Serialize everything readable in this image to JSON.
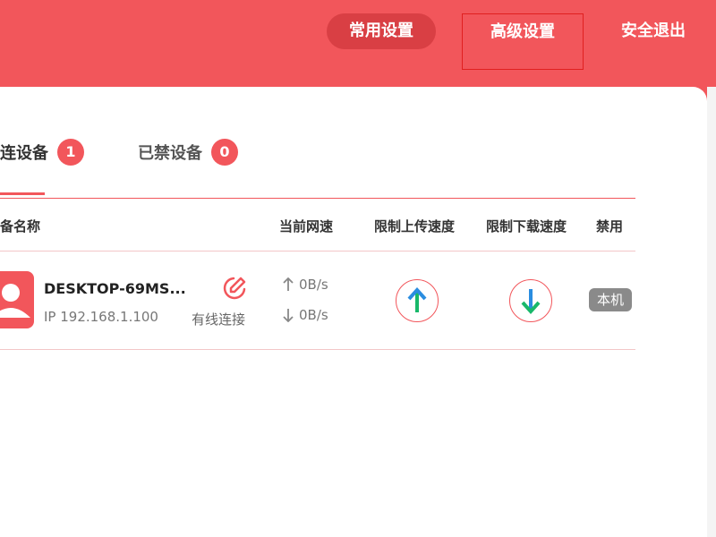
{
  "nav": {
    "common_settings": "常用设置",
    "advanced_settings": "高级设置",
    "logout": "安全退出"
  },
  "tabs": {
    "connected": {
      "label": "连设备",
      "count": "1"
    },
    "blocked": {
      "label": "已禁设备",
      "count": "0"
    }
  },
  "table": {
    "headers": {
      "name": "备名称",
      "speed": "当前网速",
      "limit_upload": "限制上传速度",
      "limit_download": "限制下载速度",
      "ban": "禁用"
    },
    "rows": [
      {
        "device_name": "DESKTOP-69MS...",
        "ip": "IP 192.168.1.100",
        "connection_type": "有线连接",
        "upload_speed": "0B/s",
        "download_speed": "0B/s",
        "ban_status": "本机"
      }
    ]
  },
  "colors": {
    "brand": "#f2565b",
    "brand_dark": "#d93f44",
    "up_arrow": "#18b86a",
    "down_arrow": "#2a8de0"
  },
  "icons": [
    "user-avatar-icon",
    "edit-icon",
    "arrow-up-icon",
    "arrow-down-icon"
  ]
}
